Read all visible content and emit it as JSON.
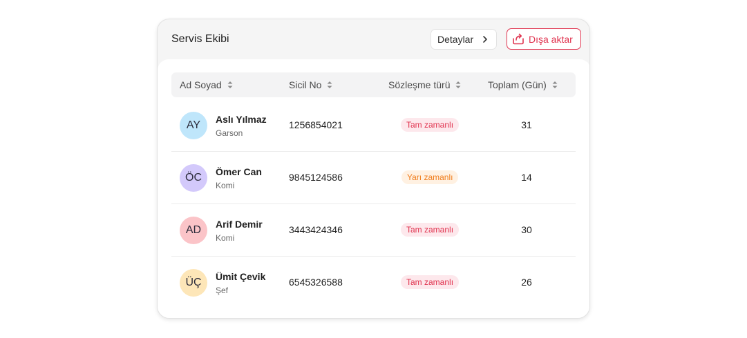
{
  "header": {
    "title": "Servis Ekibi",
    "details_label": "Detaylar",
    "export_label": "Dışa aktar"
  },
  "table": {
    "columns": [
      "Ad Soyad",
      "Sicil No",
      "Sözleşme türü",
      "Toplam (Gün)"
    ],
    "rows": [
      {
        "initials": "AY",
        "name": "Aslı Yılmaz",
        "role": "Garson",
        "sicil": "1256854021",
        "contract": "Tam zamanlı",
        "days": "31",
        "avatar_color": "#bfe6fb",
        "badge_bg": "#fde8ec",
        "badge_fg": "#e0334f"
      },
      {
        "initials": "ÖC",
        "name": "Ömer Can",
        "role": "Komi",
        "sicil": "9845124586",
        "contract": "Yarı zamanlı",
        "days": "14",
        "avatar_color": "#d3c9fb",
        "badge_bg": "#fff1e2",
        "badge_fg": "#f07c1b"
      },
      {
        "initials": "AD",
        "name": "Arif Demir",
        "role": "Komi",
        "sicil": "3443424346",
        "contract": "Tam zamanlı",
        "days": "30",
        "avatar_color": "#fbc4c8",
        "badge_bg": "#fde8ec",
        "badge_fg": "#e0334f"
      },
      {
        "initials": "ÜÇ",
        "name": "Ümit Çevik",
        "role": "Şef",
        "sicil": "6545326588",
        "contract": "Tam zamanlı",
        "days": "26",
        "avatar_color": "#fde6b8",
        "badge_bg": "#fde8ec",
        "badge_fg": "#e0334f"
      }
    ]
  },
  "colors": {
    "accent": "#e0334f",
    "part_time": "#f07c1b"
  },
  "icons": {
    "details": "chevron-right-icon",
    "export": "share-upload-icon",
    "sort": "sort-arrows-icon"
  }
}
